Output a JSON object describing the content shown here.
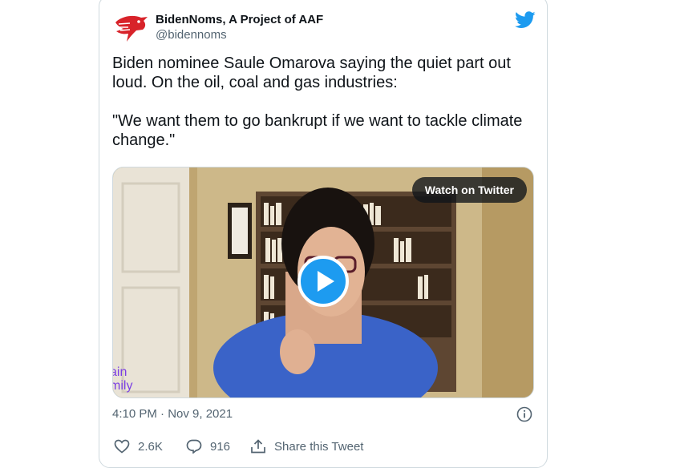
{
  "tweet": {
    "author": {
      "display_name": "BidenNoms, A Project of AAF",
      "handle": "@bidennoms",
      "avatar_icon": "eagle-logo-icon",
      "brand_color": "#d8232a"
    },
    "platform_icon": "twitter-bird-icon",
    "platform_color": "#1d9bf0",
    "text": "Biden nominee Saule Omarova saying the quiet part out loud. On the oil, coal and gas industries:\n\n\"We want them to go bankrupt if we want to tackle climate change.\"",
    "media": {
      "watch_label": "Watch on Twitter",
      "play_icon": "play-icon",
      "play_color": "#1d9bf0",
      "overlay_text": "ain\nmily"
    },
    "timestamp": "4:10 PM · Nov 9, 2021",
    "info_icon": "info-icon",
    "actions": {
      "likes": "2.6K",
      "replies": "916",
      "share_label": "Share this Tweet"
    }
  }
}
